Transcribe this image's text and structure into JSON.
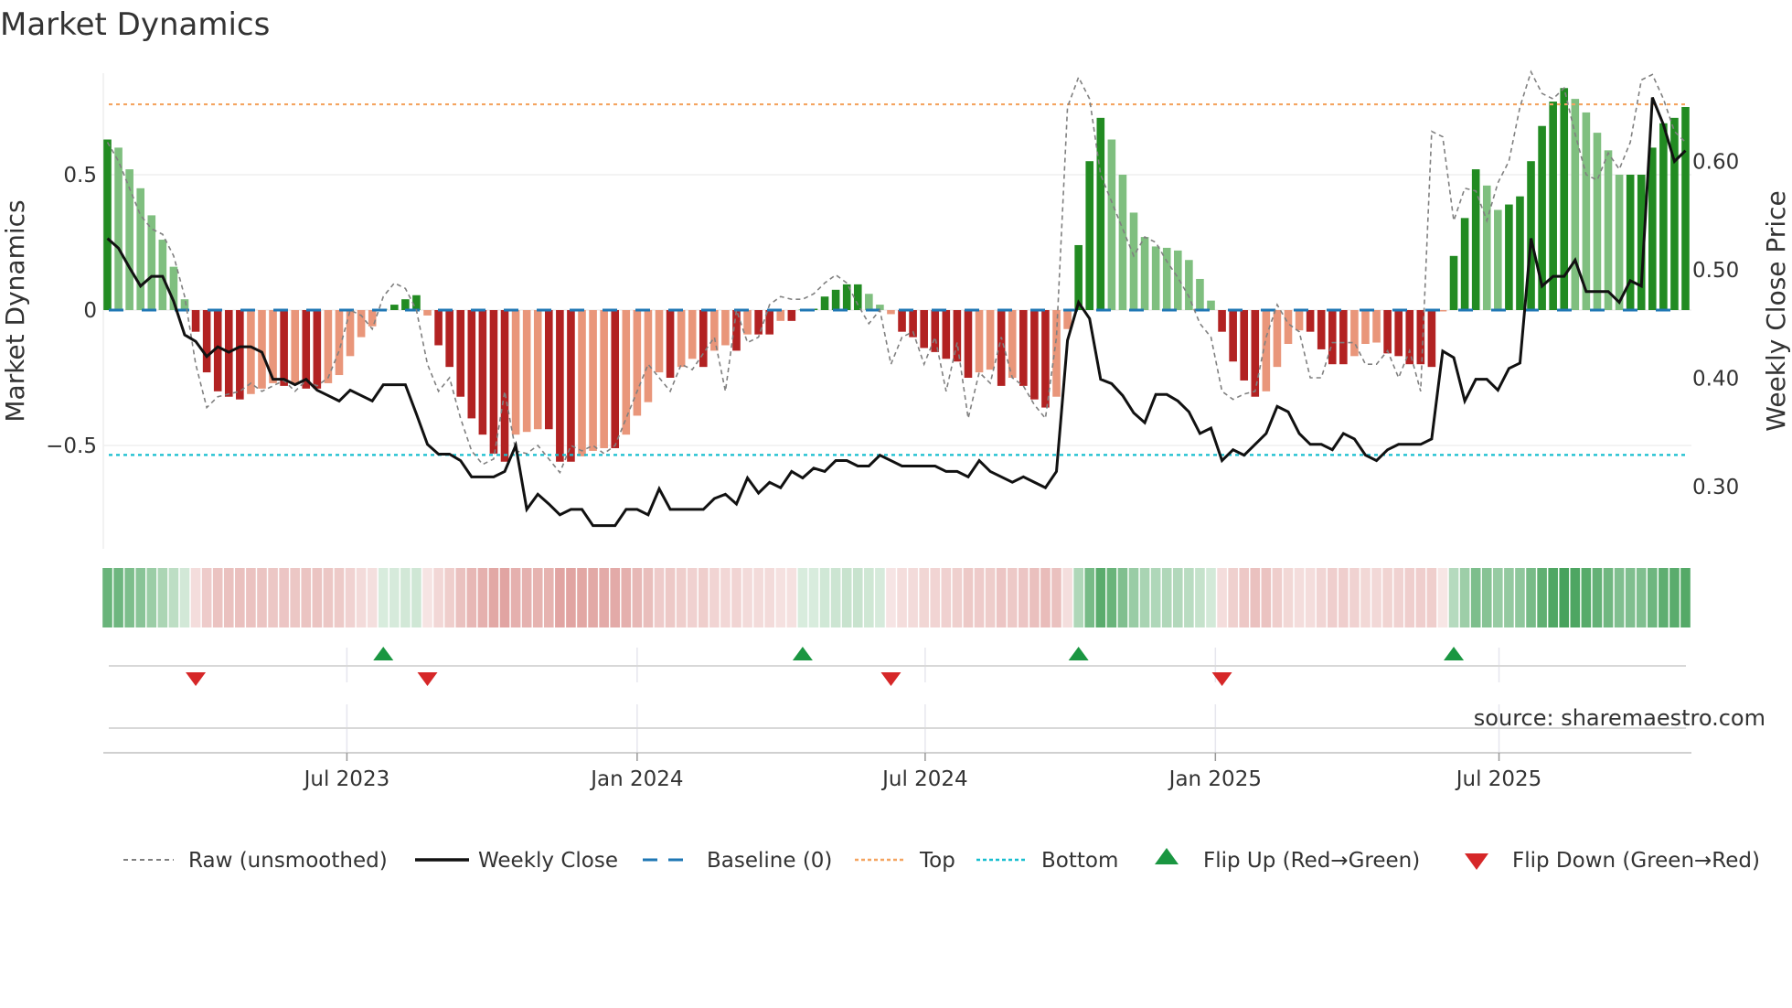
{
  "chart_data": {
    "type": "bar",
    "title": "Market Dynamics",
    "ylabel": "Market Dynamics",
    "y2label": "Weekly Close Price",
    "source": "source: sharemaestro.com",
    "frequency": "weekly",
    "start_date": "2023-01-30",
    "ylim": [
      -0.88,
      0.88
    ],
    "y2lim": [
      0.24,
      0.7
    ],
    "yticks": [
      {
        "value": 0.5,
        "label": "0.5"
      },
      {
        "value": 0,
        "label": "0"
      },
      {
        "value": -0.5,
        "label": "−0.5"
      }
    ],
    "y2ticks": [
      {
        "value": 0.6,
        "label": "0.60"
      },
      {
        "value": 0.5,
        "label": "0.50"
      },
      {
        "value": 0.4,
        "label": "0.40"
      },
      {
        "value": 0.3,
        "label": "0.30"
      }
    ],
    "xticks": [
      {
        "week": 21.7,
        "label": "Jul 2023"
      },
      {
        "week": 48.0,
        "label": "Jan 2024"
      },
      {
        "week": 74.1,
        "label": "Jul 2024"
      },
      {
        "week": 100.4,
        "label": "Jan 2025"
      },
      {
        "week": 126.1,
        "label": "Jul 2025"
      }
    ],
    "top_level": 0.76,
    "bottom_level": -0.535,
    "baseline": 0,
    "colors": {
      "green_strong": "#228b22",
      "green_weak": "#7fbf7f",
      "red_strong": "#b22222",
      "red_weak": "#e9967a",
      "raw": "#808080",
      "close": "#111111",
      "baseline": "#1f77b4",
      "top": "#f4a460",
      "bottom": "#17becf",
      "flip_up": "#1a9641",
      "flip_down": "#d62728"
    },
    "series": [
      {
        "name": "Market Dynamics",
        "values": [
          0.63,
          0.6,
          0.52,
          0.45,
          0.35,
          0.26,
          0.16,
          0.04,
          -0.08,
          -0.23,
          -0.3,
          -0.32,
          -0.33,
          -0.31,
          -0.29,
          -0.27,
          -0.28,
          -0.27,
          -0.29,
          -0.29,
          -0.27,
          -0.24,
          -0.17,
          -0.1,
          -0.06,
          0.005,
          0.02,
          0.04,
          0.055,
          -0.02,
          -0.13,
          -0.21,
          -0.32,
          -0.4,
          -0.46,
          -0.53,
          -0.56,
          -0.46,
          -0.45,
          -0.44,
          -0.44,
          -0.56,
          -0.56,
          -0.54,
          -0.52,
          -0.51,
          -0.51,
          -0.46,
          -0.39,
          -0.34,
          -0.23,
          -0.25,
          -0.21,
          -0.18,
          -0.21,
          -0.15,
          -0.13,
          -0.15,
          -0.09,
          -0.09,
          -0.09,
          -0.04,
          -0.04,
          0.003,
          0.005,
          0.05,
          0.075,
          0.095,
          0.095,
          0.06,
          0.02,
          -0.015,
          -0.08,
          -0.1,
          -0.14,
          -0.155,
          -0.18,
          -0.19,
          -0.25,
          -0.23,
          -0.22,
          -0.28,
          -0.25,
          -0.28,
          -0.33,
          -0.36,
          -0.32,
          -0.07,
          0.24,
          0.55,
          0.71,
          0.63,
          0.5,
          0.36,
          0.27,
          0.235,
          0.23,
          0.22,
          0.185,
          0.115,
          0.035,
          -0.08,
          -0.19,
          -0.26,
          -0.32,
          -0.3,
          -0.21,
          -0.125,
          -0.075,
          -0.08,
          -0.145,
          -0.2,
          -0.2,
          -0.17,
          -0.125,
          -0.12,
          -0.16,
          -0.17,
          -0.2,
          -0.2,
          -0.21,
          -0.005,
          0.2,
          0.34,
          0.52,
          0.46,
          0.37,
          0.39,
          0.42,
          0.55,
          0.68,
          0.77,
          0.82,
          0.78,
          0.73,
          0.655,
          0.59,
          0.5,
          0.5,
          0.5,
          0.6,
          0.69,
          0.71,
          0.75
        ]
      },
      {
        "name": "Raw (unsmoothed)",
        "values": [
          0.62,
          0.55,
          0.45,
          0.35,
          0.3,
          0.28,
          0.2,
          0.05,
          -0.2,
          -0.36,
          -0.32,
          -0.31,
          -0.3,
          -0.27,
          -0.3,
          -0.28,
          -0.26,
          -0.3,
          -0.26,
          -0.28,
          -0.25,
          -0.15,
          0.0,
          -0.02,
          -0.07,
          0.05,
          0.1,
          0.08,
          0.0,
          -0.2,
          -0.3,
          -0.25,
          -0.4,
          -0.52,
          -0.57,
          -0.55,
          -0.3,
          -0.52,
          -0.53,
          -0.5,
          -0.55,
          -0.6,
          -0.5,
          -0.52,
          -0.5,
          -0.53,
          -0.5,
          -0.4,
          -0.3,
          -0.2,
          -0.25,
          -0.3,
          -0.2,
          -0.22,
          -0.16,
          -0.1,
          -0.3,
          0.0,
          -0.12,
          -0.1,
          0.02,
          0.05,
          0.04,
          0.04,
          0.06,
          0.1,
          0.13,
          0.1,
          0.02,
          -0.05,
          0.0,
          -0.2,
          -0.1,
          -0.08,
          -0.2,
          -0.1,
          -0.3,
          -0.12,
          -0.4,
          -0.23,
          -0.27,
          -0.1,
          -0.25,
          -0.28,
          -0.35,
          -0.4,
          -0.1,
          0.75,
          0.86,
          0.78,
          0.5,
          0.4,
          0.3,
          0.2,
          0.27,
          0.25,
          0.18,
          0.12,
          0.05,
          -0.05,
          -0.1,
          -0.3,
          -0.33,
          -0.31,
          -0.3,
          -0.1,
          0.02,
          -0.05,
          -0.08,
          -0.25,
          -0.25,
          -0.12,
          -0.12,
          -0.12,
          -0.2,
          -0.2,
          -0.15,
          -0.25,
          -0.15,
          -0.3,
          0.66,
          0.64,
          0.33,
          0.45,
          0.44,
          0.33,
          0.47,
          0.55,
          0.75,
          0.88,
          0.8,
          0.78,
          0.82,
          0.65,
          0.5,
          0.48,
          0.58,
          0.52,
          0.62,
          0.85,
          0.87,
          0.78,
          0.66,
          0.62
        ]
      },
      {
        "name": "Weekly Close",
        "axis": "right",
        "values": [
          0.529,
          0.52,
          0.502,
          0.485,
          0.494,
          0.494,
          0.471,
          0.44,
          0.434,
          0.42,
          0.429,
          0.424,
          0.429,
          0.429,
          0.424,
          0.399,
          0.399,
          0.394,
          0.399,
          0.389,
          0.384,
          0.379,
          0.389,
          0.384,
          0.379,
          0.394,
          0.394,
          0.394,
          0.367,
          0.339,
          0.33,
          0.33,
          0.324,
          0.309,
          0.309,
          0.309,
          0.314,
          0.338,
          0.279,
          0.293,
          0.284,
          0.274,
          0.279,
          0.279,
          0.264,
          0.264,
          0.264,
          0.279,
          0.279,
          0.274,
          0.298,
          0.279,
          0.279,
          0.279,
          0.279,
          0.289,
          0.293,
          0.284,
          0.308,
          0.294,
          0.304,
          0.299,
          0.314,
          0.308,
          0.317,
          0.314,
          0.324,
          0.324,
          0.319,
          0.319,
          0.329,
          0.324,
          0.319,
          0.319,
          0.319,
          0.319,
          0.314,
          0.314,
          0.309,
          0.324,
          0.314,
          0.309,
          0.304,
          0.309,
          0.304,
          0.299,
          0.314,
          0.435,
          0.47,
          0.455,
          0.399,
          0.395,
          0.384,
          0.368,
          0.359,
          0.385,
          0.385,
          0.379,
          0.369,
          0.349,
          0.354,
          0.324,
          0.334,
          0.329,
          0.339,
          0.349,
          0.374,
          0.369,
          0.349,
          0.339,
          0.339,
          0.334,
          0.349,
          0.344,
          0.329,
          0.324,
          0.334,
          0.339,
          0.339,
          0.339,
          0.344,
          0.425,
          0.419,
          0.379,
          0.399,
          0.399,
          0.389,
          0.409,
          0.414,
          0.529,
          0.485,
          0.494,
          0.494,
          0.509,
          0.48,
          0.48,
          0.48,
          0.47,
          0.49,
          0.485,
          0.659,
          0.634,
          0.6,
          0.61
        ]
      }
    ],
    "flips": {
      "up_weeks": [
        25,
        63,
        88,
        122
      ],
      "down_weeks": [
        8,
        29,
        71,
        101
      ]
    },
    "legend": {
      "placement": "bottom",
      "items": [
        "Raw (unsmoothed)",
        "Weekly Close",
        "Baseline (0)",
        "Top",
        "Bottom",
        "Flip Up (Red→Green)",
        "Flip Down (Green→Red)"
      ]
    }
  }
}
